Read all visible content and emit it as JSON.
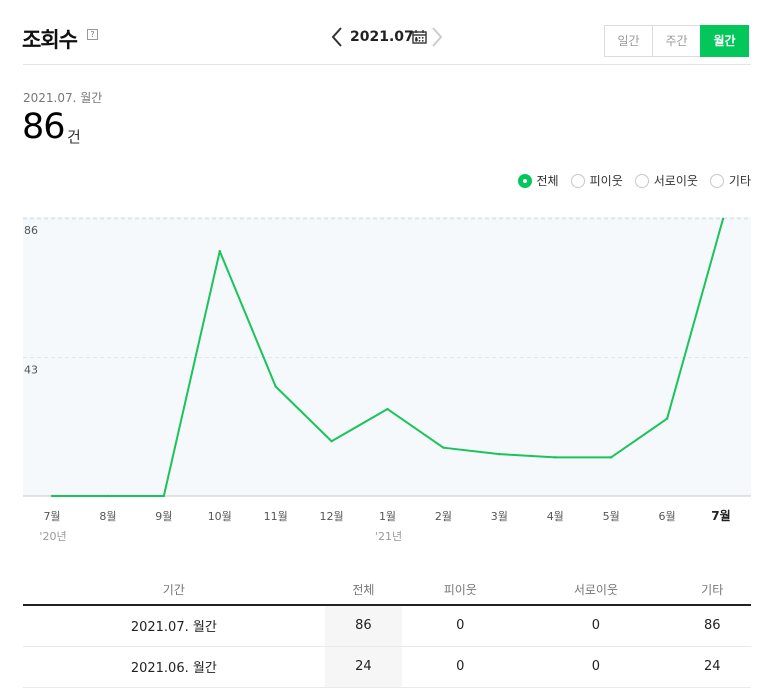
{
  "header": {
    "title": "조회수",
    "help_icon": "?",
    "date_label": "2021.07.",
    "tabs": [
      {
        "label": "일간",
        "active": false
      },
      {
        "label": "주간",
        "active": false
      },
      {
        "label": "월간",
        "active": true
      }
    ]
  },
  "summary": {
    "period": "2021.07. 월간",
    "value": "86",
    "unit": "건"
  },
  "filters": [
    {
      "label": "전체",
      "checked": true
    },
    {
      "label": "피이웃",
      "checked": false
    },
    {
      "label": "서로이웃",
      "checked": false
    },
    {
      "label": "기타",
      "checked": false
    }
  ],
  "colors": {
    "accent": "#03c75a",
    "chart_line": "#1bc45b",
    "chart_bg": "#f5f9fb"
  },
  "chart_data": {
    "type": "line",
    "x": [
      "7월",
      "8월",
      "9월",
      "10월",
      "11월",
      "12월",
      "1월",
      "2월",
      "3월",
      "4월",
      "5월",
      "6월",
      "7월"
    ],
    "year_labels": [
      "'20년",
      "",
      "",
      "",
      "",
      "",
      "'21년",
      "",
      "",
      "",
      "",
      "",
      ""
    ],
    "series": [
      {
        "values": [
          0,
          0,
          0,
          76,
          34,
          17,
          27,
          15,
          13,
          12,
          12,
          24,
          86
        ]
      }
    ],
    "y_ticks": [
      43,
      86
    ],
    "ylim": [
      0,
      86
    ],
    "grid": true
  },
  "table": {
    "headers": [
      "기간",
      "전체",
      "피이웃",
      "서로이웃",
      "기타"
    ],
    "rows": [
      [
        "2021.07. 월간",
        "86",
        "0",
        "0",
        "86"
      ],
      [
        "2021.06. 월간",
        "24",
        "0",
        "0",
        "24"
      ]
    ]
  }
}
